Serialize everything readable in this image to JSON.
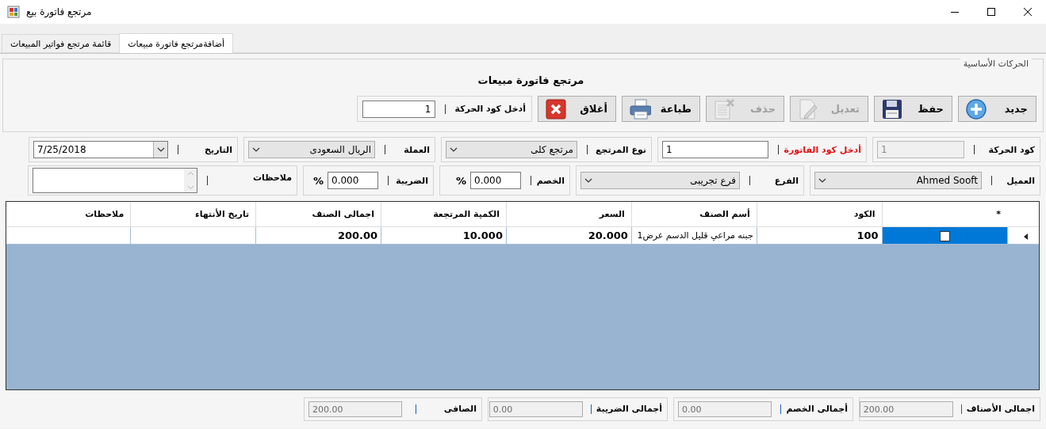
{
  "window": {
    "title": "مرتجع فاتورة بيع"
  },
  "tabs": [
    {
      "label": "أضافةمرتجع فاتورة مبيعات",
      "selected": true
    },
    {
      "label": "قائمة مرتجع فواتير المبيعات",
      "selected": false
    }
  ],
  "main_group": {
    "title": "الحركات الأساسية",
    "heading": "مرتجع فاتورة مبيعات",
    "buttons": [
      {
        "kind": "new",
        "label": "جديد",
        "disabled": false
      },
      {
        "kind": "save",
        "label": "حفظ",
        "disabled": false
      },
      {
        "kind": "edit",
        "label": "تعديل",
        "disabled": true
      },
      {
        "kind": "delete",
        "label": "حذف",
        "disabled": true
      },
      {
        "kind": "print",
        "label": "طباعة",
        "disabled": false
      },
      {
        "kind": "close",
        "label": "أغلاق",
        "disabled": false
      }
    ],
    "movement_lookup": {
      "label": "أدخل كود الحركة",
      "value": "1"
    }
  },
  "field_rows": [
    [
      {
        "kind": "text",
        "label": "كود الحركة",
        "value": "1",
        "disabled": true,
        "emphasized": false
      },
      {
        "kind": "text",
        "label": "أدخل كود الفاتورة",
        "value": "1",
        "disabled": false,
        "emphasized": true
      },
      {
        "kind": "select",
        "label": "نوع المرتجع",
        "value": "مرتجع كلى",
        "disabled": false,
        "emphasized": false
      },
      {
        "kind": "select",
        "label": "العملة",
        "value": "الريال السعودى",
        "disabled": false,
        "emphasized": false
      },
      {
        "kind": "date",
        "label": "التاريخ",
        "value": "7/25/2018",
        "disabled": false,
        "emphasized": false
      }
    ],
    [
      {
        "kind": "select",
        "label": "العميل",
        "value": "Ahmed Sooft",
        "disabled": false,
        "emphasized": false
      },
      {
        "kind": "select",
        "label": "الفرع",
        "value": "فرع تجريبى",
        "disabled": false,
        "emphasized": false
      },
      {
        "kind": "percent",
        "label": "الخصم",
        "value": "0.000",
        "suffix": "%",
        "disabled": false,
        "emphasized": false
      },
      {
        "kind": "percent",
        "label": "الضريبة",
        "value": "0.000",
        "suffix": "%",
        "disabled": false,
        "emphasized": false
      },
      {
        "kind": "memo",
        "label": "ملاحظات",
        "disabled": false,
        "emphasized": false
      }
    ]
  ],
  "grid": {
    "columns": [
      "*",
      "الكود",
      "أسم الصنف",
      "السعر",
      "الكمية المرتجعة",
      "اجمالى الصنف",
      "تاريخ الأنتهاء",
      "ملاحظات"
    ],
    "rows": [
      {
        "selected": true,
        "checked": false,
        "cells": [
          "",
          "100",
          "جبنه مراعي قليل الدسم عرض1",
          "20.000",
          "10.000",
          "200.00",
          "",
          ""
        ]
      }
    ]
  },
  "totals": [
    {
      "label": "اجمالى الأصناف",
      "value": "200.00",
      "disabled": true
    },
    {
      "label": "أجمالى الخصم",
      "value": "0.00",
      "disabled": true
    },
    {
      "label": "أجمالى الضريبة",
      "value": "0.00",
      "disabled": true
    },
    {
      "label": "الصافى",
      "value": "200.00",
      "disabled": true
    }
  ]
}
